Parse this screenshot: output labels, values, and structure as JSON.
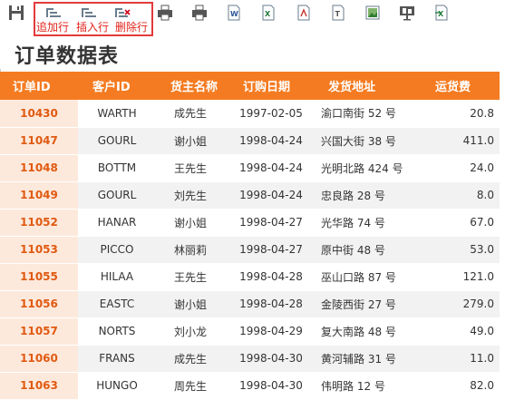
{
  "toolbar": {
    "icons": [
      "save-icon",
      "append-row-icon",
      "insert-row-icon",
      "delete-row-icon",
      "print-icon",
      "print-preview-icon",
      "export-word-icon",
      "export-excel-icon",
      "export-pdf-icon",
      "export-text-icon",
      "export-image-icon",
      "present-icon",
      "export-excel-alt-icon"
    ],
    "append_label": "追加行",
    "insert_label": "插入行",
    "delete_label": "删除行"
  },
  "page_title": "订单数据表",
  "table": {
    "headers": [
      "订单ID",
      "客户ID",
      "货主名称",
      "订购日期",
      "发货地址",
      "运货费"
    ],
    "rows": [
      [
        "10430",
        "WARTH",
        "成先生",
        "1997-02-05",
        "渝口南街 52 号",
        "20.8"
      ],
      [
        "11047",
        "GOURL",
        "谢小姐",
        "1998-04-24",
        "兴国大街 38 号",
        "411.0"
      ],
      [
        "11048",
        "BOTTM",
        "王先生",
        "1998-04-24",
        "光明北路 424 号",
        "24.0"
      ],
      [
        "11049",
        "GOURL",
        "刘先生",
        "1998-04-24",
        "忠良路 28 号",
        "8.0"
      ],
      [
        "11052",
        "HANAR",
        "谢小姐",
        "1998-04-27",
        "光华路 74 号",
        "67.0"
      ],
      [
        "11053",
        "PICCO",
        "林丽莉",
        "1998-04-27",
        "原中街 48 号",
        "53.0"
      ],
      [
        "11055",
        "HILAA",
        "王先生",
        "1998-04-28",
        "巫山口路 87 号",
        "121.0"
      ],
      [
        "11056",
        "EASTC",
        "谢小姐",
        "1998-04-28",
        "金陵西街 27 号",
        "279.0"
      ],
      [
        "11057",
        "NORTS",
        "刘小龙",
        "1998-04-29",
        "复大南路 48 号",
        "49.0"
      ],
      [
        "11060",
        "FRANS",
        "成先生",
        "1998-04-30",
        "黄河辅路 31 号",
        "11.0"
      ],
      [
        "11063",
        "HUNGO",
        "周先生",
        "1998-04-30",
        "伟明路 12 号",
        "82.0"
      ]
    ]
  },
  "colors": {
    "header_bg": "#f47b21",
    "id_cell_bg": "#fde9dc",
    "id_text": "#e05a12",
    "toolbar_highlight": "#e23b3b"
  }
}
